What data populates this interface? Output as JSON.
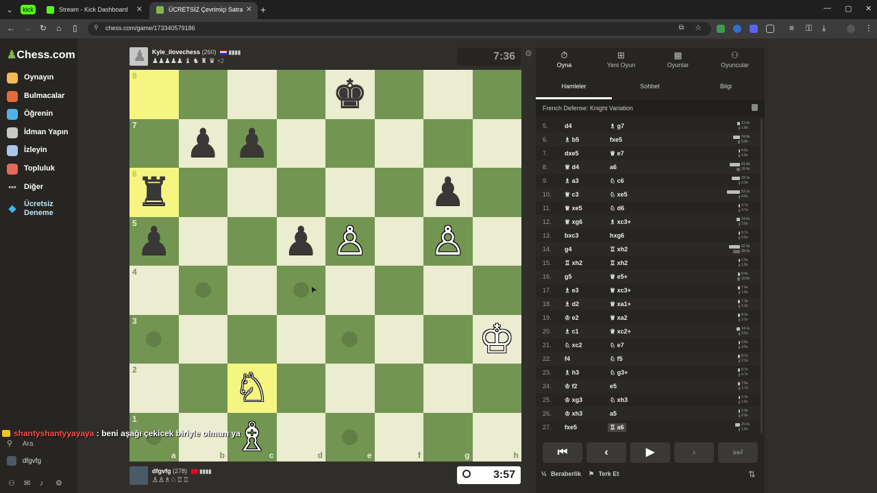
{
  "browser": {
    "tabs": [
      {
        "label": "Stream - Kick Dashboard",
        "active": false
      },
      {
        "label": "ÜCRETSİZ Çevrimiçi Satranç Oy",
        "active": true
      }
    ],
    "kick_badge": "kick",
    "url": "chess.com/game/173340579186"
  },
  "sidebar": {
    "logo": "Chess.com",
    "items": [
      {
        "label": "Oynayın",
        "icon": "pawn-hand-icon",
        "color": "#f7b955"
      },
      {
        "label": "Bulmacalar",
        "icon": "puzzle-icon",
        "color": "#e56b35"
      },
      {
        "label": "Öğrenin",
        "icon": "cap-icon",
        "color": "#4fb2e6"
      },
      {
        "label": "İdman Yapın",
        "icon": "train-icon",
        "color": "#c9c9c9"
      },
      {
        "label": "İzleyin",
        "icon": "binoculars-icon",
        "color": "#a9c6e8"
      },
      {
        "label": "Topluluk",
        "icon": "community-icon",
        "color": "#e36b5a"
      },
      {
        "label": "Diğer",
        "icon": "more-icon",
        "color": "#bbb"
      },
      {
        "label": "Ücretsiz Deneme",
        "icon": "diamond-icon",
        "color": "#3fb4e6"
      }
    ],
    "search": "Ara",
    "username": "dfgvfg"
  },
  "top_player": {
    "name": "Kyle_ilovechess",
    "rating": "(260)",
    "captures": "♟♟♟♟♟ ♝ ♞ ♜ ♛",
    "material": "+2",
    "clock": "7:36"
  },
  "bottom_player": {
    "name": "dfgvfg",
    "rating": "(278)",
    "captures": "♙♙♗♘♖♖",
    "clock": "3:57"
  },
  "board": {
    "files": [
      "a",
      "b",
      "c",
      "d",
      "e",
      "f",
      "g",
      "h"
    ],
    "ranks": [
      "8",
      "7",
      "6",
      "5",
      "4",
      "3",
      "2",
      "1"
    ],
    "pieces": [
      {
        "sq": "e8",
        "glyph": "♚",
        "side": "b",
        "name": "black-king"
      },
      {
        "sq": "b7",
        "glyph": "♟",
        "side": "b",
        "name": "black-pawn"
      },
      {
        "sq": "c7",
        "glyph": "♟",
        "side": "b",
        "name": "black-pawn"
      },
      {
        "sq": "a6",
        "glyph": "♜",
        "side": "b",
        "name": "black-rook"
      },
      {
        "sq": "g6",
        "glyph": "♟",
        "side": "b",
        "name": "black-pawn"
      },
      {
        "sq": "a5",
        "glyph": "♟",
        "side": "b",
        "name": "black-pawn"
      },
      {
        "sq": "d5",
        "glyph": "♟",
        "side": "b",
        "name": "black-pawn"
      },
      {
        "sq": "e5",
        "glyph": "♙",
        "side": "w",
        "name": "white-pawn"
      },
      {
        "sq": "g5",
        "glyph": "♙",
        "side": "w",
        "name": "white-pawn"
      },
      {
        "sq": "h3",
        "glyph": "♔",
        "side": "w",
        "name": "white-king"
      },
      {
        "sq": "c2",
        "glyph": "♘",
        "side": "w",
        "name": "white-knight"
      },
      {
        "sq": "c1",
        "glyph": "♗",
        "side": "w",
        "name": "white-bishop"
      }
    ],
    "highlights": [
      "a8",
      "a6",
      "c2"
    ],
    "move_dots": [
      "b4",
      "d4",
      "a3",
      "e3",
      "a1",
      "e1"
    ]
  },
  "chat_overlay": {
    "user": "shantyshantyyayaya",
    "message": " : beni aşağı çekicek biriyle olmam ya"
  },
  "panel": {
    "tabs": [
      {
        "label": "Oyna",
        "icon": "stopwatch-icon",
        "active": true
      },
      {
        "label": "Yeni Oyun",
        "icon": "plus-icon",
        "active": false
      },
      {
        "label": "Oyunlar",
        "icon": "board-icon",
        "active": false
      },
      {
        "label": "Oyuncular",
        "icon": "players-icon",
        "active": false
      }
    ],
    "subtabs": [
      {
        "label": "Hamleler",
        "active": true
      },
      {
        "label": "Sohbet",
        "active": false
      },
      {
        "label": "Bilgi",
        "active": false
      }
    ],
    "opening": "French Defense: Knight Variation",
    "moves": [
      {
        "n": "5.",
        "w": "d4",
        "b": "♗ g7",
        "tw": "12.4s",
        "tb": "1.8s",
        "fw": 0.12,
        "fb": 0.05
      },
      {
        "n": "6.",
        "w": "♗ b5",
        "b": "fxe5",
        "tw": "24.8s",
        "tb": "5.8s",
        "fw": 0.3,
        "fb": 0.08
      },
      {
        "n": "7.",
        "w": "dxe5",
        "b": "♕ e7",
        "tw": "4.9s",
        "tb": "1.9s",
        "fw": 0.06,
        "fb": 0.04
      },
      {
        "n": "8.",
        "w": "♕ d4",
        "b": "a6",
        "tw": "41.9s",
        "tb": "10.4s",
        "fw": 0.45,
        "fb": 0.14
      },
      {
        "n": "9.",
        "w": "♗ a3",
        "b": "♘ c6",
        "tw": "33.1s",
        "tb": "2.3s",
        "fw": 0.36,
        "fb": 0.04
      },
      {
        "n": "10.",
        "w": "♕ c3",
        "b": "♘ xe5",
        "tw": "53.1s",
        "tb": "4.6s",
        "fw": 0.55,
        "fb": 0.06
      },
      {
        "n": "11.",
        "w": "♕ xe5",
        "b": "♘ d6",
        "tw": "3.7s",
        "tb": "3.7s",
        "fw": 0.05,
        "fb": 0.05
      },
      {
        "n": "12.",
        "w": "♕ xg6",
        "b": "♗ xc3+",
        "tw": "14.5s",
        "tb": "2.8s",
        "fw": 0.15,
        "fb": 0.04
      },
      {
        "n": "13.",
        "w": "bxc3",
        "b": "hxg6",
        "tw": "5.7s",
        "tb": "5.5s",
        "fw": 0.06,
        "fb": 0.06
      },
      {
        "n": "14.",
        "w": "g4",
        "b": "♖ xh2",
        "tw": "42.5s",
        "tb": "28.0s",
        "fw": 0.46,
        "fb": 0.3
      },
      {
        "n": "15.",
        "w": "♖ xh2",
        "b": "♖ xh2",
        "tw": "2.5s",
        "tb": "1.8s",
        "fw": 0.04,
        "fb": 0.03
      },
      {
        "n": "16.",
        "w": "g5",
        "b": "♕ e5+",
        "tw": "9.4s",
        "tb": "10.8s",
        "fw": 0.1,
        "fb": 0.12
      },
      {
        "n": "17.",
        "w": "♗ e3",
        "b": "♕ xc3+",
        "tw": "7.9s",
        "tb": "1.6s",
        "fw": 0.08,
        "fb": 0.03
      },
      {
        "n": "18.",
        "w": "♗ d2",
        "b": "♕ xa1+",
        "tw": "7.3s",
        "tb": "1.3s",
        "fw": 0.08,
        "fb": 0.02
      },
      {
        "n": "19.",
        "w": "♔ e2",
        "b": "♕ xa2",
        "tw": "8.3s",
        "tb": "2.1s",
        "fw": 0.09,
        "fb": 0.03
      },
      {
        "n": "20.",
        "w": "♗ c1",
        "b": "♕ xc2+",
        "tw": "14.1s",
        "tb": "2.5s",
        "fw": 0.15,
        "fb": 0.04
      },
      {
        "n": "21.",
        "w": "♘ xc2",
        "b": "♘ e7",
        "tw": "2.6s",
        "tb": "3.5s",
        "fw": 0.04,
        "fb": 0.05
      },
      {
        "n": "22.",
        "w": "f4",
        "b": "♘ f5",
        "tw": "8.7s",
        "tb": "2.1s",
        "fw": 0.09,
        "fb": 0.03
      },
      {
        "n": "23.",
        "w": "♗ h3",
        "b": "♘ g3+",
        "tw": "9.7s",
        "tb": "4.7s",
        "fw": 0.1,
        "fb": 0.06
      },
      {
        "n": "24.",
        "w": "♔ f2",
        "b": "e5",
        "tw": "7.5s",
        "tb": "1.7s",
        "fw": 0.08,
        "fb": 0.03
      },
      {
        "n": "25.",
        "w": "♔ xg3",
        "b": "♘ xh3",
        "tw": "1.3s",
        "tb": "1.6s",
        "fw": 0.02,
        "fb": 0.03
      },
      {
        "n": "26.",
        "w": "♔ xh3",
        "b": "a5",
        "tw": "1.4s",
        "tb": "2.9s",
        "fw": 0.02,
        "fb": 0.04
      },
      {
        "n": "27.",
        "w": "fxe5",
        "b": "♖ a6",
        "tw": "20.0s",
        "tb": "1.6s",
        "fw": 0.21,
        "fb": 0.03,
        "selected": true
      }
    ],
    "nav": [
      {
        "glyph": "⏮",
        "name": "first-move-button",
        "dim": false
      },
      {
        "glyph": "‹",
        "name": "prev-move-button",
        "dim": false
      },
      {
        "glyph": "▶",
        "name": "play-button",
        "dim": false
      },
      {
        "glyph": "›",
        "name": "next-move-button",
        "dim": true
      },
      {
        "glyph": "⏭",
        "name": "last-move-button",
        "dim": true
      }
    ],
    "draw_label": "Beraberlik",
    "draw_prefix": "½",
    "resign_label": "Terk Et"
  }
}
